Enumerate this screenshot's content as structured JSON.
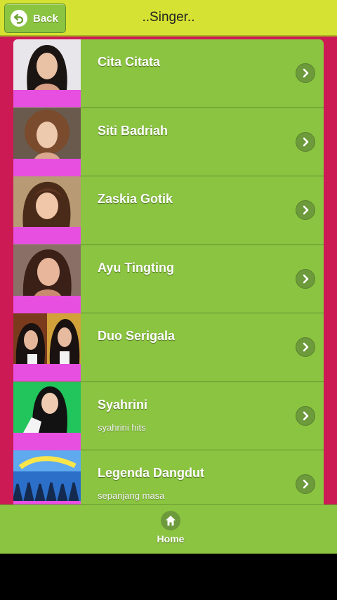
{
  "header": {
    "back_label": "Back",
    "title": "..Singer.."
  },
  "singers": [
    {
      "name": "Cita Citata",
      "subtitle": ""
    },
    {
      "name": "Siti Badriah",
      "subtitle": ""
    },
    {
      "name": "Zaskia Gotik",
      "subtitle": ""
    },
    {
      "name": "Ayu Tingting",
      "subtitle": ""
    },
    {
      "name": "Duo Serigala",
      "subtitle": ""
    },
    {
      "name": "Syahrini",
      "subtitle": "syahrini hits"
    },
    {
      "name": "Legenda Dangdut",
      "subtitle": "sepanjang masa"
    }
  ],
  "footer": {
    "home_label": "Home"
  },
  "colors": {
    "topbar": "#d6e233",
    "background": "#cc1a55",
    "item": "#8bc441",
    "thumb_band": "#e64fe0"
  }
}
